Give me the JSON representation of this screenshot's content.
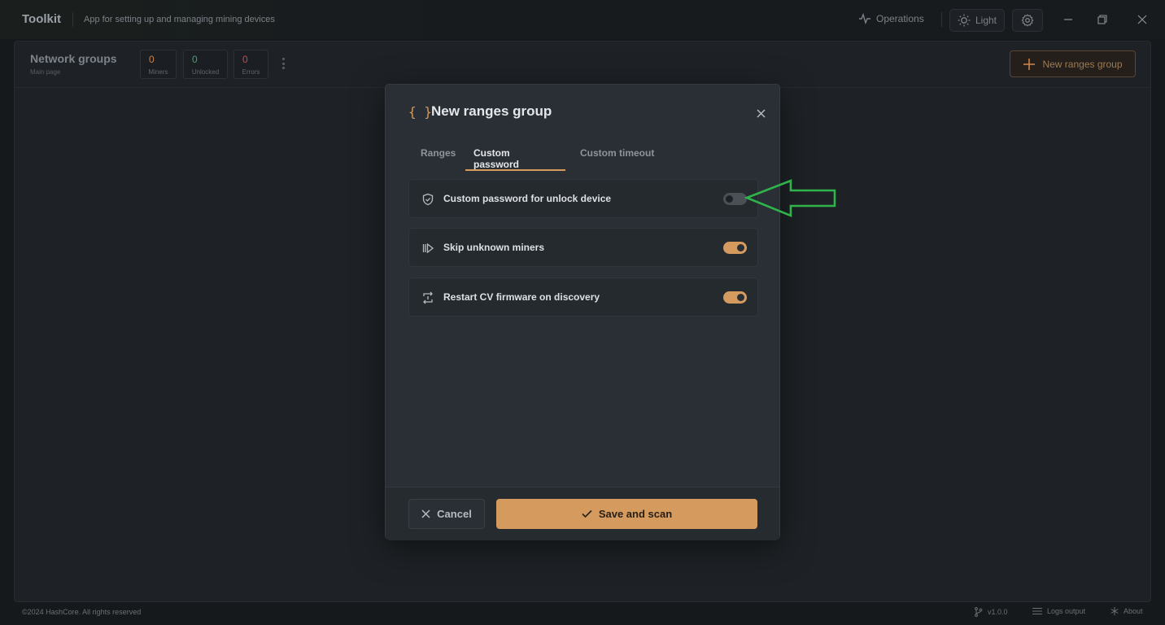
{
  "app": {
    "title": "Toolkit",
    "subtitle": "App for setting up and managing mining devices"
  },
  "titlebar": {
    "operations_label": "Operations",
    "theme_label": "Light"
  },
  "header": {
    "title": "Network groups",
    "subtitle": "Main page",
    "stats": [
      {
        "value": "0",
        "label": "Miners",
        "color": "#c9834a"
      },
      {
        "value": "0",
        "label": "Unlocked",
        "color": "#3fa46a"
      },
      {
        "value": "0",
        "label": "Errors",
        "color": "#c84a4a"
      }
    ],
    "new_group_label": "New ranges group"
  },
  "modal": {
    "title": "New ranges group",
    "tabs": [
      {
        "label": "Ranges",
        "active": false
      },
      {
        "label": "Custom password",
        "active": true
      },
      {
        "label": "Custom timeout",
        "active": false
      }
    ],
    "options": [
      {
        "label": "Custom password for unlock device",
        "icon": "shield-check-icon",
        "enabled": false
      },
      {
        "label": "Skip unknown miners",
        "icon": "skip-forward-icon",
        "enabled": true
      },
      {
        "label": "Restart CV firmware on discovery",
        "icon": "restart-icon",
        "enabled": true
      }
    ],
    "cancel_label": "Cancel",
    "save_label": "Save and scan"
  },
  "footer": {
    "copyright": "©2024 HashCore. All rights reserved",
    "version": "v1.0.0",
    "logs_label": "Logs output",
    "about_label": "About"
  },
  "colors": {
    "accent": "#d49a5e",
    "annotation_arrow": "#2fb34a"
  }
}
